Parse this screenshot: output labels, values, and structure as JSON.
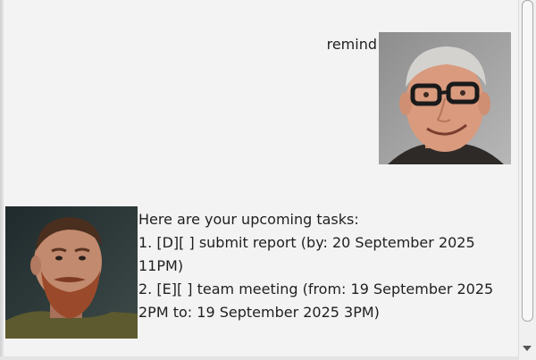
{
  "chat": {
    "user_message": {
      "text": "remind",
      "avatar": "user-photo-avatar"
    },
    "bot_message": {
      "avatar": "bot-photo-avatar",
      "lines": [
        "Here are your upcoming tasks:",
        "1. [D][ ] submit report (by: 20 September 2025",
        "11PM)",
        "2. [E][ ] team meeting (from: 19 September 2025",
        "2PM to: 19 September 2025 3PM)"
      ]
    }
  },
  "scrollbar": {
    "down_arrow_icon": "chevron-down-icon"
  }
}
